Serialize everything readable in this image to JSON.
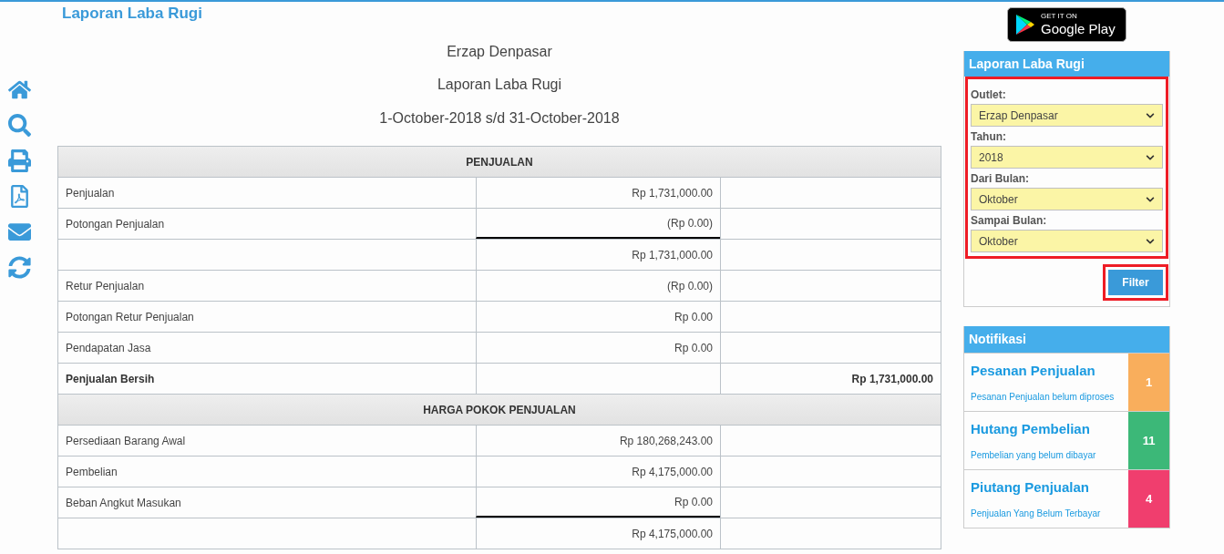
{
  "page_title": "Laporan Laba Rugi",
  "side_icons": [
    {
      "kind": "home"
    },
    {
      "kind": "search"
    },
    {
      "kind": "print"
    },
    {
      "kind": "pdf"
    },
    {
      "kind": "mail"
    },
    {
      "kind": "refresh"
    }
  ],
  "report": {
    "company": "Erzap Denpasar",
    "title": "Laporan Laba Rugi",
    "period": "1-October-2018 s/d 31-October-2018"
  },
  "table": {
    "rows": [
      {
        "kind": "section",
        "label": "PENJUALAN"
      },
      {
        "kind": "row",
        "label": "Penjualan",
        "amount": "Rp 1,731,000.00",
        "total": "",
        "bold": false,
        "rule_below": false
      },
      {
        "kind": "row",
        "label": "Potongan Penjualan",
        "amount": "(Rp 0.00)",
        "total": "",
        "bold": false,
        "rule_below": true
      },
      {
        "kind": "row",
        "label": "",
        "amount": "Rp 1,731,000.00",
        "total": "",
        "bold": false,
        "rule_below": false
      },
      {
        "kind": "row",
        "label": "Retur Penjualan",
        "amount": "(Rp 0.00)",
        "total": "",
        "bold": false,
        "rule_below": false
      },
      {
        "kind": "row",
        "label": "Potongan Retur Penjualan",
        "amount": "Rp 0.00",
        "total": "",
        "bold": false,
        "rule_below": false
      },
      {
        "kind": "row",
        "label": "Pendapatan Jasa",
        "amount": "Rp 0.00",
        "total": "",
        "bold": false,
        "rule_below": false
      },
      {
        "kind": "row",
        "label": "Penjualan Bersih",
        "amount": "",
        "total": "Rp 1,731,000.00",
        "bold": true,
        "rule_below": false
      },
      {
        "kind": "section",
        "label": "HARGA POKOK PENJUALAN"
      },
      {
        "kind": "row",
        "label": "Persediaan Barang Awal",
        "amount": "Rp 180,268,243.00",
        "total": "",
        "bold": false,
        "rule_below": false
      },
      {
        "kind": "row",
        "label": "Pembelian",
        "amount": "Rp 4,175,000.00",
        "total": "",
        "bold": false,
        "rule_below": false
      },
      {
        "kind": "row",
        "label": "Beban Angkut Masukan",
        "amount": "Rp 0.00",
        "total": "",
        "bold": false,
        "rule_below": true
      },
      {
        "kind": "row",
        "label": "",
        "amount": "Rp 4,175,000.00",
        "total": "",
        "bold": false,
        "rule_below": false
      }
    ]
  },
  "store_badge": {
    "small": "GET IT ON",
    "large": "Google Play"
  },
  "filter_panel": {
    "title": "Laporan Laba Rugi",
    "highlighted": true,
    "fields": [
      {
        "label": "Outlet:",
        "value": "Erzap Denpasar"
      },
      {
        "label": "Tahun:",
        "value": "2018"
      },
      {
        "label": "Dari Bulan:",
        "value": "Oktober"
      },
      {
        "label": "Sampai Bulan:",
        "value": "Oktober"
      }
    ],
    "button": {
      "label": "Filter",
      "highlighted": true
    }
  },
  "notifications": {
    "title": "Notifikasi",
    "items": [
      {
        "title": "Pesanan Penjualan",
        "subtitle": "Pesanan Penjualan belum diproses",
        "count": "1",
        "color": "#f9ae5c"
      },
      {
        "title": "Hutang Pembelian",
        "subtitle": "Pembelian yang belum dibayar",
        "count": "11",
        "color": "#3cb878"
      },
      {
        "title": "Piutang Penjualan",
        "subtitle": "Penjualan Yang Belum Terbayar",
        "count": "4",
        "color": "#f03e6e"
      }
    ]
  }
}
